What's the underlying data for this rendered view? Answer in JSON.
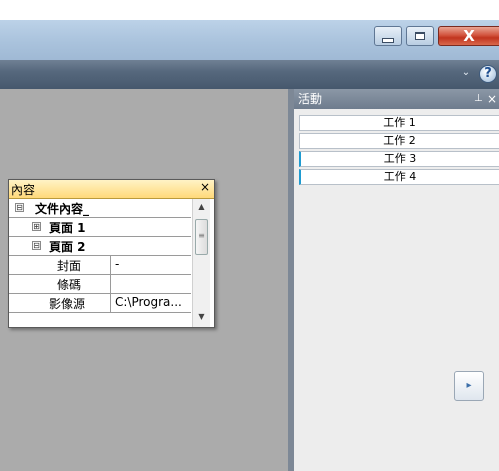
{
  "window": {
    "minimize_icon": "minimize-icon",
    "maximize_icon": "maximize-icon",
    "close_glyph": "X"
  },
  "ribbon": {
    "chevron_glyph": "⌄",
    "help_glyph": "?"
  },
  "activity_panel": {
    "title": "活動",
    "pin_glyph": "⊥",
    "close_glyph": "×",
    "items": [
      {
        "label": "工作 1"
      },
      {
        "label": "工作 2"
      },
      {
        "label": "工作 3"
      },
      {
        "label": "工作 4"
      }
    ],
    "next_glyph": "▸"
  },
  "properties": {
    "title": "內容",
    "close_glyph": "×",
    "rows": [
      {
        "label": "文件內容_",
        "value": "",
        "expander": "⊟"
      },
      {
        "label": "頁面 1",
        "value": "",
        "expander": "⊞"
      },
      {
        "label": "頁面 2",
        "value": "",
        "expander": "⊟"
      },
      {
        "label": "封面",
        "value": "-",
        "expander": ""
      },
      {
        "label": "條碼",
        "value": "",
        "expander": ""
      },
      {
        "label": "影像源",
        "value": "C:\\Progra...",
        "expander": ""
      }
    ]
  },
  "colors": {
    "workspace": "#ababab",
    "panel_header": "#7f8b9a",
    "active_item_accent": "#1f9bd1",
    "close_button": "#c1341f"
  }
}
